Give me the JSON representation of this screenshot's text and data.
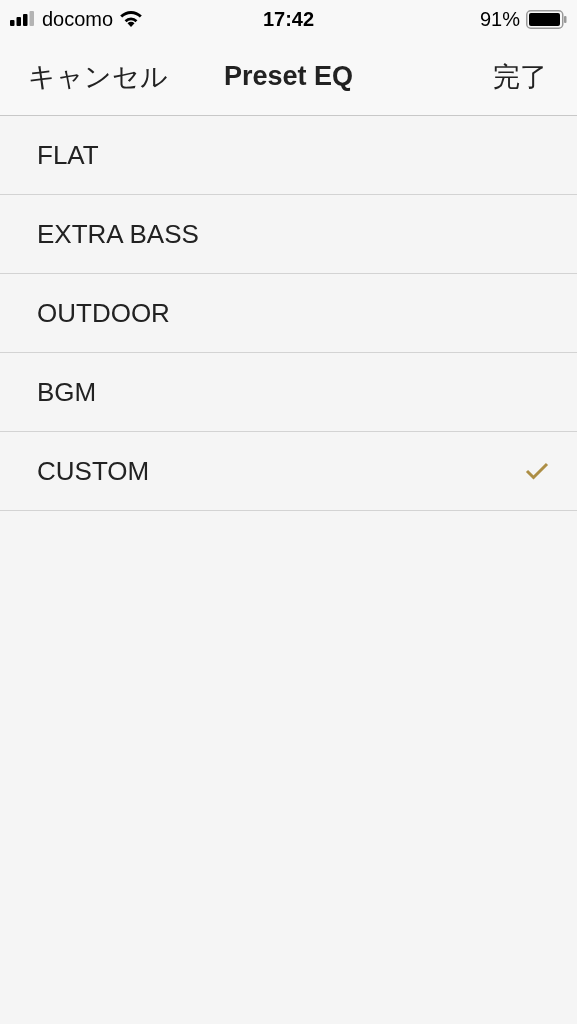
{
  "status_bar": {
    "carrier": "docomo",
    "time": "17:42",
    "battery": "91%"
  },
  "nav_bar": {
    "cancel": "キャンセル",
    "title": "Preset EQ",
    "done": "完了"
  },
  "presets": [
    {
      "label": "FLAT",
      "selected": false
    },
    {
      "label": "EXTRA BASS",
      "selected": false
    },
    {
      "label": "OUTDOOR",
      "selected": false
    },
    {
      "label": "BGM",
      "selected": false
    },
    {
      "label": "CUSTOM",
      "selected": true
    }
  ]
}
